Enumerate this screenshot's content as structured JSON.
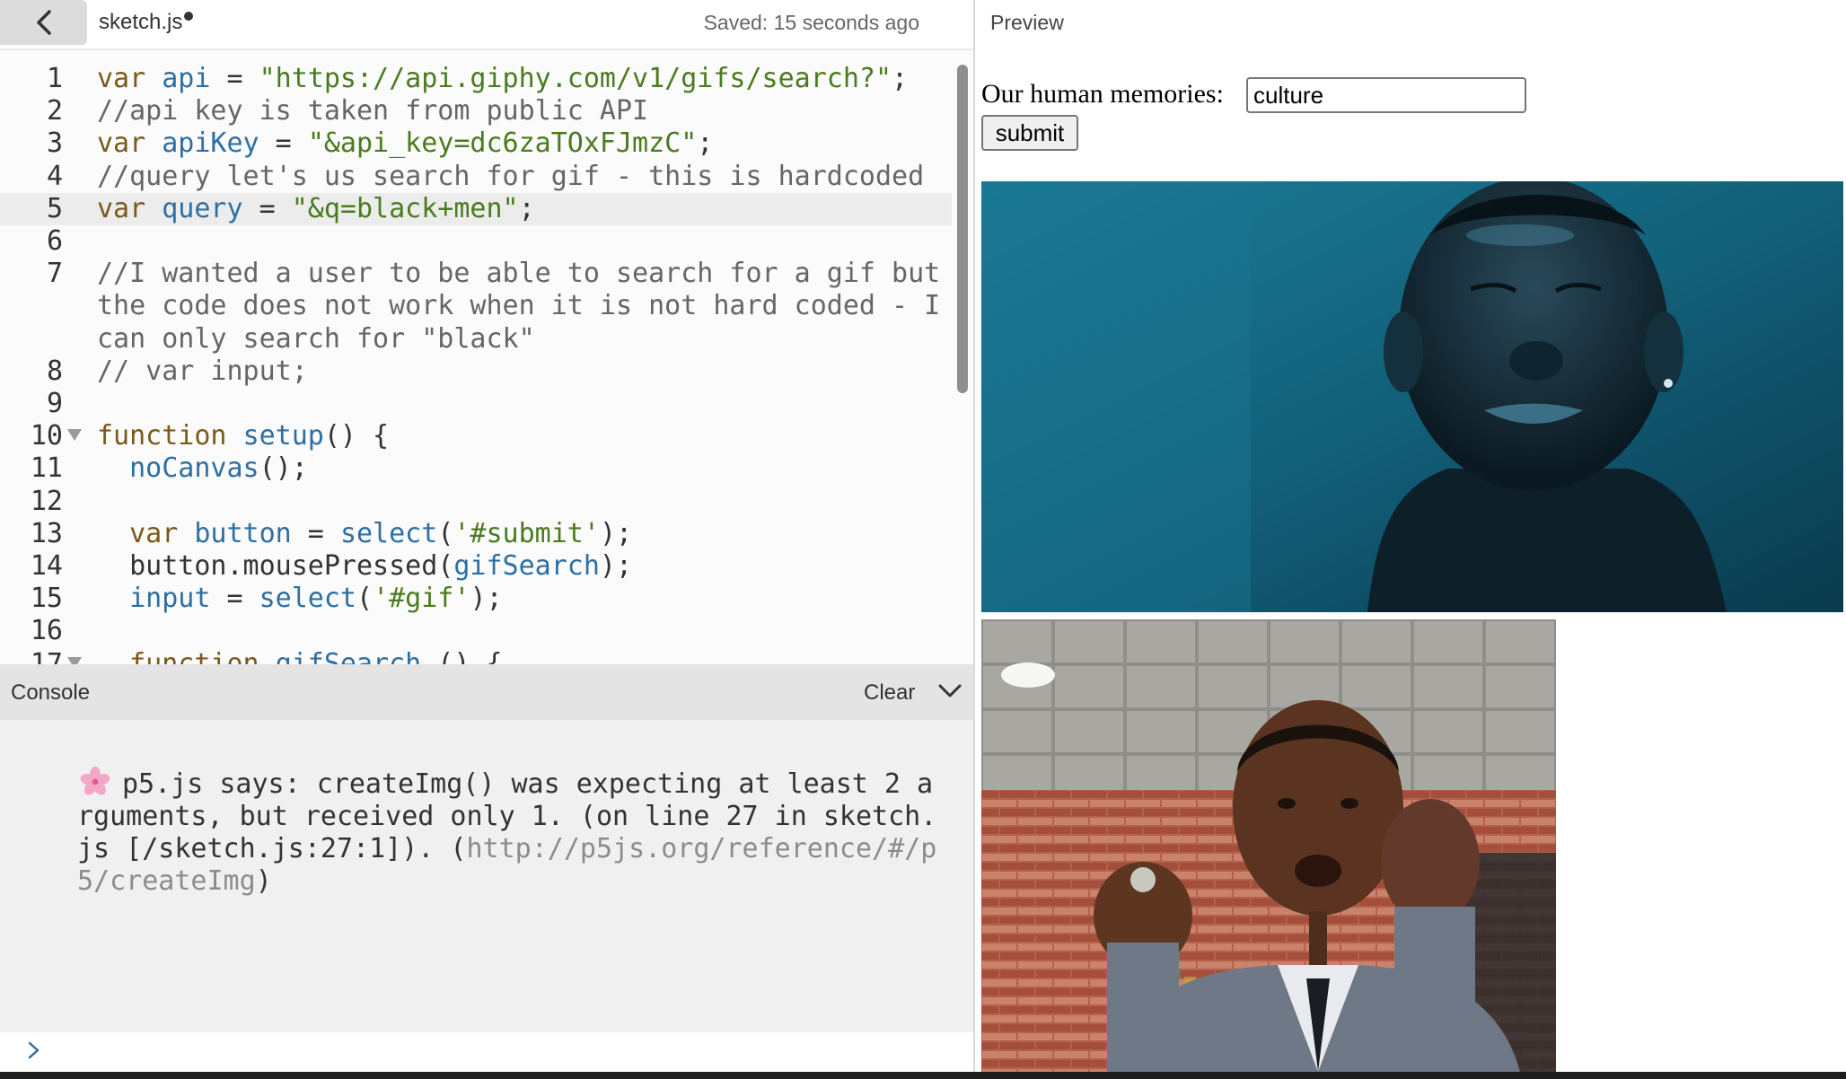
{
  "editor": {
    "file_name": "sketch.js",
    "saved_status": "Saved: 15 seconds ago",
    "lines": [
      {
        "num": "1",
        "tokens": [
          {
            "t": "var ",
            "c": "kw"
          },
          {
            "t": "api",
            "c": "var"
          },
          {
            "t": " = ",
            "c": "plain"
          },
          {
            "t": "\"https://api.giphy.com/v1/gifs/search?\"",
            "c": "str"
          },
          {
            "t": ";",
            "c": "plain"
          }
        ]
      },
      {
        "num": "2",
        "tokens": [
          {
            "t": "//api key is taken from public API",
            "c": "com"
          }
        ]
      },
      {
        "num": "3",
        "tokens": [
          {
            "t": "var ",
            "c": "kw"
          },
          {
            "t": "apiKey",
            "c": "var"
          },
          {
            "t": " = ",
            "c": "plain"
          },
          {
            "t": "\"&api_key=dc6zaTOxFJmzC\"",
            "c": "str"
          },
          {
            "t": ";",
            "c": "plain"
          }
        ]
      },
      {
        "num": "4",
        "tokens": [
          {
            "t": "//query let's us search for gif - this is hardcoded",
            "c": "com"
          }
        ]
      },
      {
        "num": "5",
        "active": true,
        "tokens": [
          {
            "t": "var ",
            "c": "kw"
          },
          {
            "t": "query",
            "c": "var"
          },
          {
            "t": " = ",
            "c": "plain"
          },
          {
            "t": "\"&q=black+men\"",
            "c": "str"
          },
          {
            "t": ";",
            "c": "plain"
          }
        ]
      },
      {
        "num": "6",
        "tokens": []
      },
      {
        "num": "7",
        "tokens": [
          {
            "t": "//I wanted a user to be able to search for a gif but",
            "c": "com"
          }
        ],
        "wrap": [
          "the code does not work when it is not hard coded - I",
          "can only search for \"black\""
        ]
      },
      {
        "num": "8",
        "tokens": [
          {
            "t": "// var input;",
            "c": "com"
          }
        ]
      },
      {
        "num": "9",
        "tokens": []
      },
      {
        "num": "10",
        "fold": true,
        "tokens": [
          {
            "t": "function ",
            "c": "kw"
          },
          {
            "t": "setup",
            "c": "var"
          },
          {
            "t": "() {",
            "c": "plain"
          }
        ]
      },
      {
        "num": "11",
        "tokens": [
          {
            "t": "  ",
            "c": "plain"
          },
          {
            "t": "noCanvas",
            "c": "var"
          },
          {
            "t": "();",
            "c": "plain"
          }
        ]
      },
      {
        "num": "12",
        "tokens": []
      },
      {
        "num": "13",
        "tokens": [
          {
            "t": "  var ",
            "c": "kw"
          },
          {
            "t": "button",
            "c": "var"
          },
          {
            "t": " = ",
            "c": "plain"
          },
          {
            "t": "select",
            "c": "var"
          },
          {
            "t": "(",
            "c": "plain"
          },
          {
            "t": "'#submit'",
            "c": "str"
          },
          {
            "t": ");",
            "c": "plain"
          }
        ]
      },
      {
        "num": "14",
        "tokens": [
          {
            "t": "  button.mousePressed(",
            "c": "plain"
          },
          {
            "t": "gifSearch",
            "c": "var"
          },
          {
            "t": ");",
            "c": "plain"
          }
        ]
      },
      {
        "num": "15",
        "tokens": [
          {
            "t": "  ",
            "c": "plain"
          },
          {
            "t": "input",
            "c": "var"
          },
          {
            "t": " = ",
            "c": "plain"
          },
          {
            "t": "select",
            "c": "var"
          },
          {
            "t": "(",
            "c": "plain"
          },
          {
            "t": "'#gif'",
            "c": "str"
          },
          {
            "t": ");",
            "c": "plain"
          }
        ]
      },
      {
        "num": "16",
        "tokens": []
      },
      {
        "num": "17",
        "fold": true,
        "tokens": [
          {
            "t": "  function ",
            "c": "kw"
          },
          {
            "t": "gifSearch",
            "c": "var"
          },
          {
            "t": " () {",
            "c": "plain"
          }
        ]
      }
    ]
  },
  "console": {
    "title": "Console",
    "clear_label": "Clear",
    "message_text": "p5.js says: createImg() was expecting at least 2 arguments, but received only 1. (on line 27 in sketch.js [/sketch.js:27:1]). (",
    "message_link": "http://p5js.org/reference/#/p5/createImg",
    "message_end": ")"
  },
  "preview": {
    "label": "Preview",
    "prompt_label": "Our human memories:",
    "search_value": "culture",
    "submit_label": "submit"
  }
}
